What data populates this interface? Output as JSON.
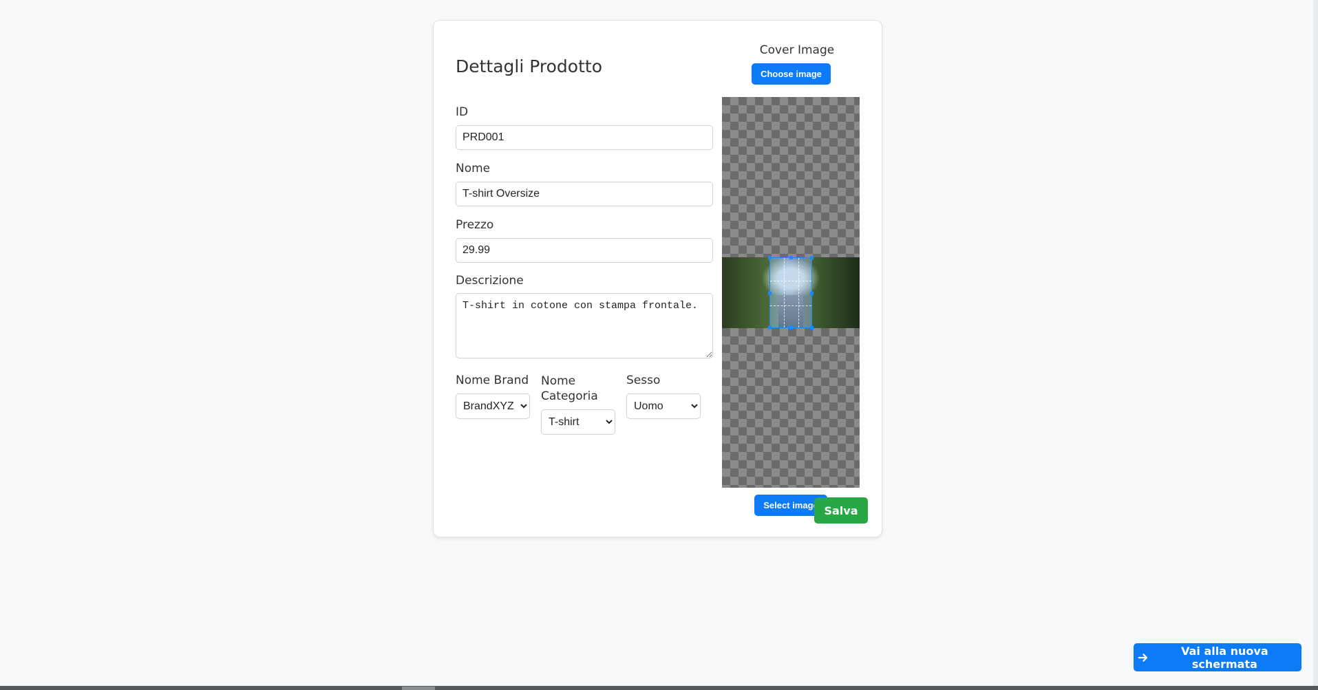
{
  "form": {
    "title": "Dettagli Prodotto",
    "id_label": "ID",
    "id_value": "PRD001",
    "name_label": "Nome",
    "name_value": "T-shirt Oversize",
    "price_label": "Prezzo",
    "price_value": "29.99",
    "description_label": "Descrizione",
    "description_value": "T-shirt in cotone con stampa frontale.",
    "brand_label": "Nome Brand",
    "brand_value": "BrandXYZ",
    "category_label_line1": "Nome",
    "category_label_line2": "Categoria",
    "category_value": "T-shirt",
    "gender_label": "Sesso",
    "gender_value": "Uomo"
  },
  "cover": {
    "label": "Cover Image",
    "choose_button": "Choose image",
    "select_button": "Select image"
  },
  "actions": {
    "save_button": "Salva",
    "next_button": "Vai alla nuova schermata",
    "next_icon": "arrow-right-icon"
  },
  "colors": {
    "primary": "#0d7bf5",
    "success": "#28a745",
    "background": "#f8f9fa"
  }
}
